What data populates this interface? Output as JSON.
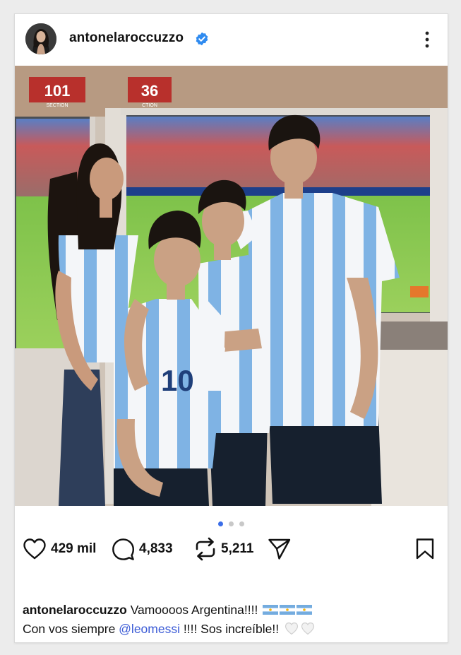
{
  "post": {
    "username": "antonelaroccuzzo",
    "verified": true,
    "menu_icon": "more-vertical-icon",
    "carousel": {
      "total": 3,
      "active_index": 0
    },
    "photo_signs": {
      "section_left": "101",
      "section_left_sub": "SECTION",
      "section_right": "36",
      "section_right_sub": "CTION"
    },
    "jersey_number": "10",
    "stats": {
      "likes": "429 mil",
      "comments": "4,833",
      "reposts": "5,211"
    },
    "caption": {
      "user": "antonelaroccuzzo",
      "line1_text": "Vamoooos Argentina!!!!",
      "line2_prefix": "Con vos siempre ",
      "mention": "@leomessi",
      "line2_suffix": " !!!! Sos increíble!! "
    },
    "colors": {
      "accent": "#3b6ee8",
      "verified": "#2f8bf0",
      "mention": "#3b5bd6",
      "jersey_blue": "#7fb3e4"
    }
  }
}
